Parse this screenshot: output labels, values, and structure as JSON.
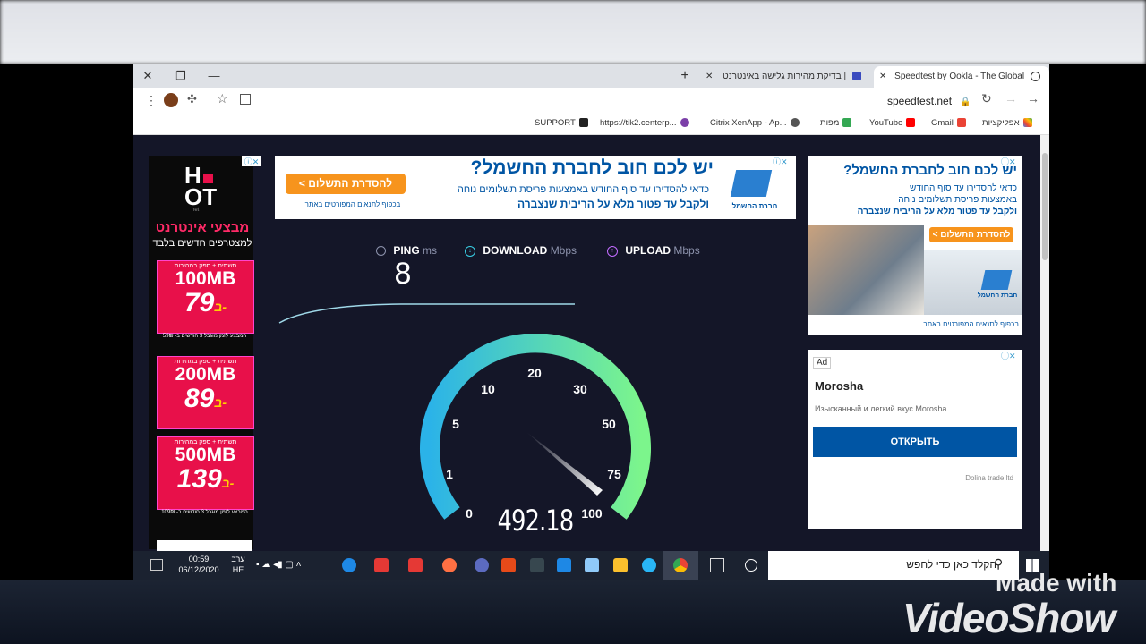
{
  "browser": {
    "tabs": [
      {
        "title": "Speedtest by Ookla - The Global",
        "active": true
      },
      {
        "title": "בדיקת מהירות גלישה באינטרנט |",
        "active": false
      }
    ],
    "address": "speedtest.net",
    "bookmarks": [
      "אפליקציות",
      "Gmail",
      "YouTube",
      "מפות",
      "Citrix XenApp - Ap...",
      "https://tik2.centerp...",
      "SUPPORT"
    ]
  },
  "ads": {
    "left": {
      "brand_top": "H",
      "brand_bottom": "OT",
      "brand_sub": "net",
      "headline": "מבצעי אינטרנט",
      "subline": "למצטרפים חדשים בלבד",
      "offers": [
        {
          "tag": "תשתית + ספק במהירות",
          "speed": "100MB",
          "price": "79",
          "note": "המבצע לזמן מוגבל 3 חודשים ב- 59₪"
        },
        {
          "tag": "תשתית + ספק במהירות",
          "speed": "200MB",
          "price": "89",
          "note": ""
        },
        {
          "tag": "תשתית + ספק במהירות",
          "speed": "500MB",
          "price": "139",
          "note": "המבצע לזמן מוגבל 3 חודשים ב- 109₪"
        }
      ],
      "price_prefix": "ב-"
    },
    "top": {
      "headline": "יש לכם חוב לחברת החשמל?",
      "line1": "כדאי להסדירו עד סוף החודש באמצעות פריסת תשלומים נוחה",
      "line2": "ולקבל עד פטור מלא על הריבית שנצברה",
      "fine": "בכפוף לתנאים המפורטים באתר",
      "cta": "להסדרת התשלום >",
      "logo": "חברת החשמל"
    },
    "right": {
      "headline": "יש לכם חוב לחברת החשמל?",
      "line1": "כדאי להסדירו עד סוף החודש",
      "line2": "באמצעות פריסת תשלומים נוחה",
      "line3": "ולקבל עד פטור מלא על הריבית שנצברה",
      "cta": "להסדרת התשלום >",
      "logo": "חברת החשמל",
      "fine": "בכפוף לתנאים המפורטים באתר"
    },
    "morosha": {
      "badge": "Ad",
      "title": "Morosha",
      "text": "Изысканный и легкий вкус Morosha.",
      "button": "ОТКРЫТЬ",
      "advertiser": "Dolina trade ltd"
    }
  },
  "speedtest": {
    "ping_label": "PING",
    "ping_unit": "ms",
    "download_label": "DOWNLOAD",
    "download_unit": "Mbps",
    "upload_label": "UPLOAD",
    "upload_unit": "Mbps",
    "ping_value": "8",
    "current_speed": "492.18",
    "dial_labels": [
      "0",
      "1",
      "5",
      "10",
      "20",
      "30",
      "50",
      "75",
      "100"
    ]
  },
  "taskbar": {
    "search_placeholder": "הקלד כאן כדי לחפש",
    "time": "00:59",
    "date": "06/12/2020",
    "day": "ערב",
    "lang": "HE"
  },
  "watermark": {
    "line1": "Made with",
    "line2": "VideoShow"
  },
  "colors": {
    "tabstrip": "#dee1e6",
    "page_bg": "#141628",
    "gauge_start": "#2bb3e8",
    "gauge_end": "#7cf58c",
    "ad_blue": "#0055a4",
    "ad_orange": "#f7941d",
    "hot_red": "#e8104a"
  }
}
